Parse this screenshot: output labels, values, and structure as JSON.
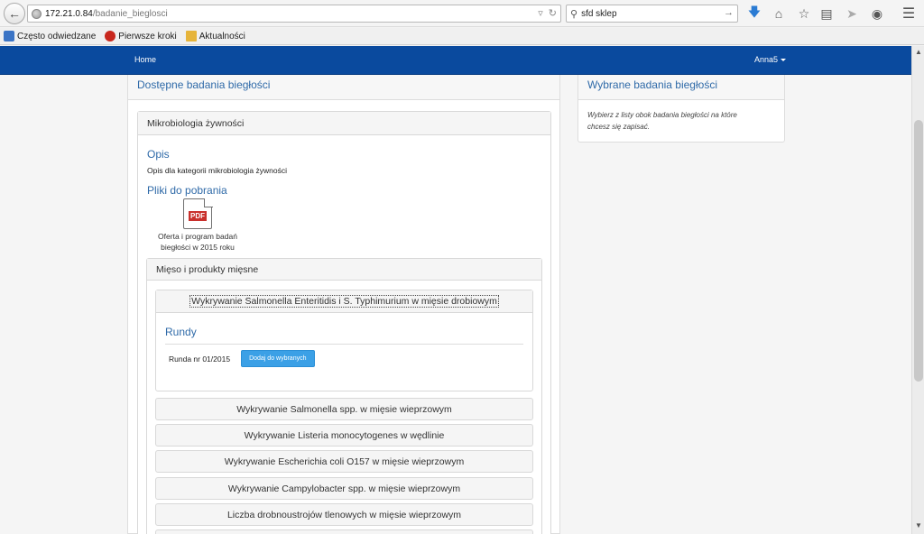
{
  "browser": {
    "url_host": "172.21.0.84",
    "url_path": "/badanie_bieglosci",
    "search_value": "sfd sklep",
    "bookmarks": [
      {
        "label": "Często odwiedzane",
        "icon": "bookmark-blue-icon"
      },
      {
        "label": "Pierwsze kroki",
        "icon": "firefox-icon"
      },
      {
        "label": "Aktualności",
        "icon": "rss-folder-icon"
      }
    ],
    "icons": [
      "download-icon",
      "home-icon",
      "star-icon",
      "clipboard-icon",
      "send-icon",
      "chat-icon",
      "menu-icon"
    ]
  },
  "navbar": {
    "home_label": "Home",
    "user_label": "Anna5"
  },
  "left": {
    "heading": "Dostępne badania biegłości",
    "category": {
      "title": "Mikrobiologia żywności",
      "opis_title": "Opis",
      "opis_text": "Opis dla kategorii mikrobiologia żywności",
      "files_title": "Pliki do pobrania",
      "pdf_tag": "PDF",
      "pdf_label_line1": "Oferta i program badań",
      "pdf_label_line2": "biegłości w 2015 roku",
      "subcategory": {
        "title": "Mięso i produkty mięsne",
        "expanded_item": {
          "title": "Wykrywanie Salmonella Enteritidis i S. Typhimurium w mięsie drobiowym",
          "rundy_title": "Rundy",
          "round_label": "Runda nr 01/2015",
          "add_button": "Dodaj do wybranych"
        },
        "items": [
          "Wykrywanie Salmonella spp. w mięsie wieprzowym",
          "Wykrywanie Listeria monocytogenes w wędlinie",
          "Wykrywanie Escherichia coli O157 w mięsie wieprzowym",
          "Wykrywanie Campylobacter spp. w mięsie wieprzowym",
          "Liczba drobnoustrojów tlenowych w mięsie wieprzowym"
        ]
      }
    }
  },
  "right": {
    "heading": "Wybrane badania biegłości",
    "body_line1": "Wybierz z listy obok badania biegłości na które",
    "body_line2": "chcesz się zapisać."
  }
}
